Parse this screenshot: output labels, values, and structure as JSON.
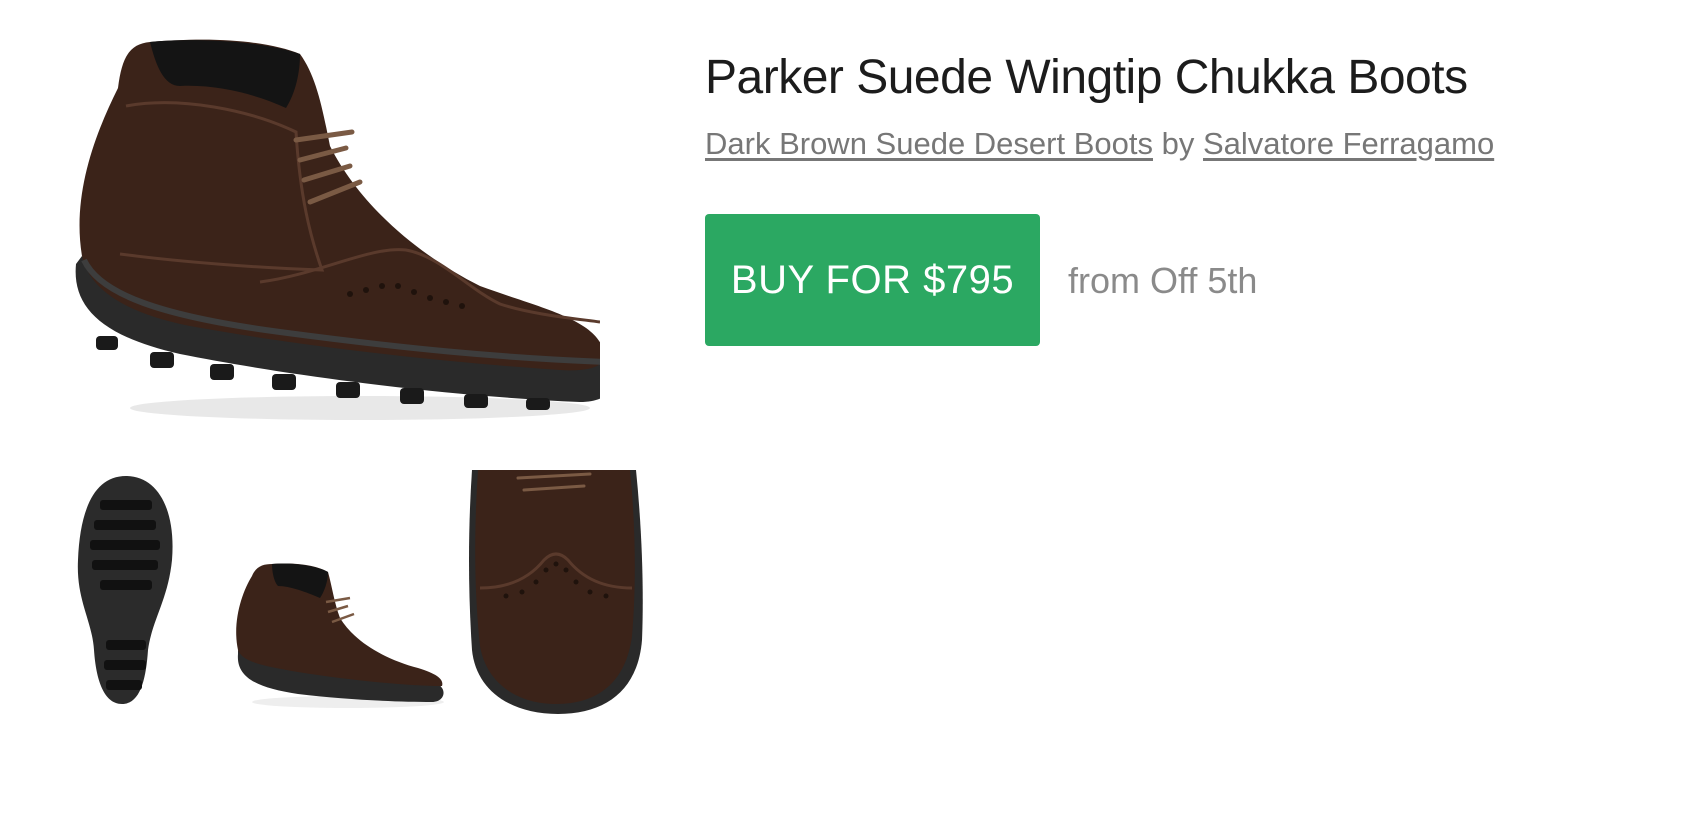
{
  "product": {
    "title": "Parker Suede Wingtip Chukka Boots",
    "category_link": "Dark Brown Suede Desert Boots",
    "by_text": "by",
    "brand_link": "Salvatore Ferragamo"
  },
  "purchase": {
    "buy_label": "BUY FOR $795",
    "from_store": "from Off 5th",
    "button_color": "#2ba862"
  },
  "gallery": {
    "main_image": "chukka-boot-three-quarter-view",
    "thumbnails": [
      "boot-sole-view",
      "boot-side-view",
      "boot-toe-top-view"
    ]
  }
}
